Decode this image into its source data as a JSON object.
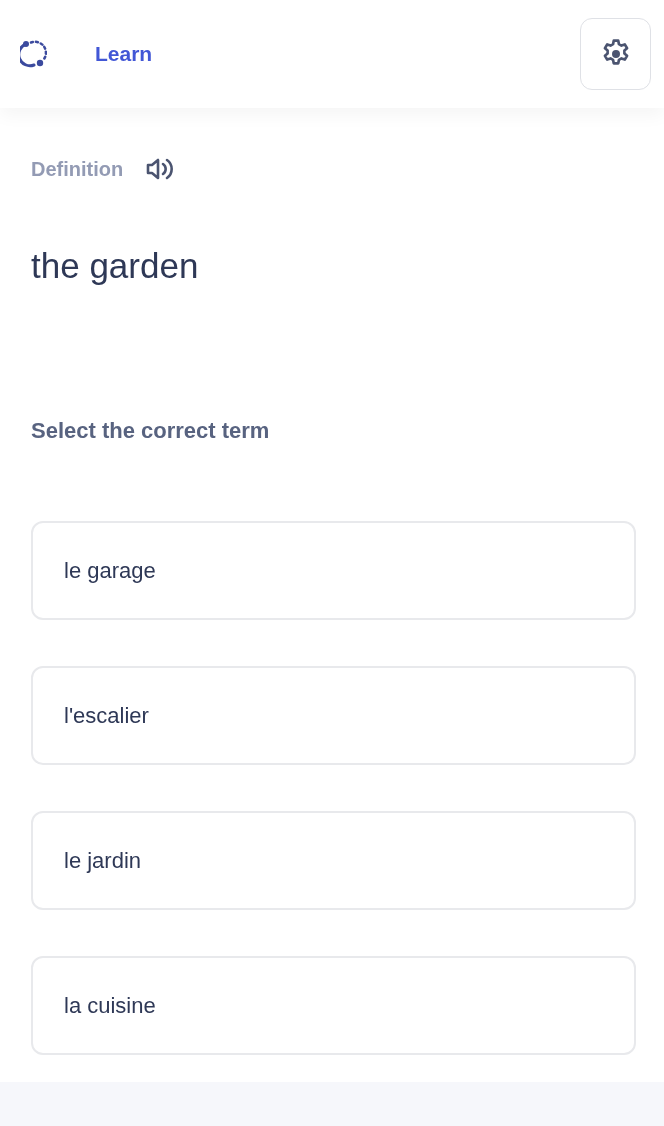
{
  "header": {
    "title": "Learn"
  },
  "prompt": {
    "label": "Definition",
    "text": "the garden"
  },
  "instruction": "Select the correct term",
  "options": [
    {
      "label": "le garage"
    },
    {
      "label": "l'escalier"
    },
    {
      "label": "le jardin"
    },
    {
      "label": "la cuisine"
    }
  ]
}
